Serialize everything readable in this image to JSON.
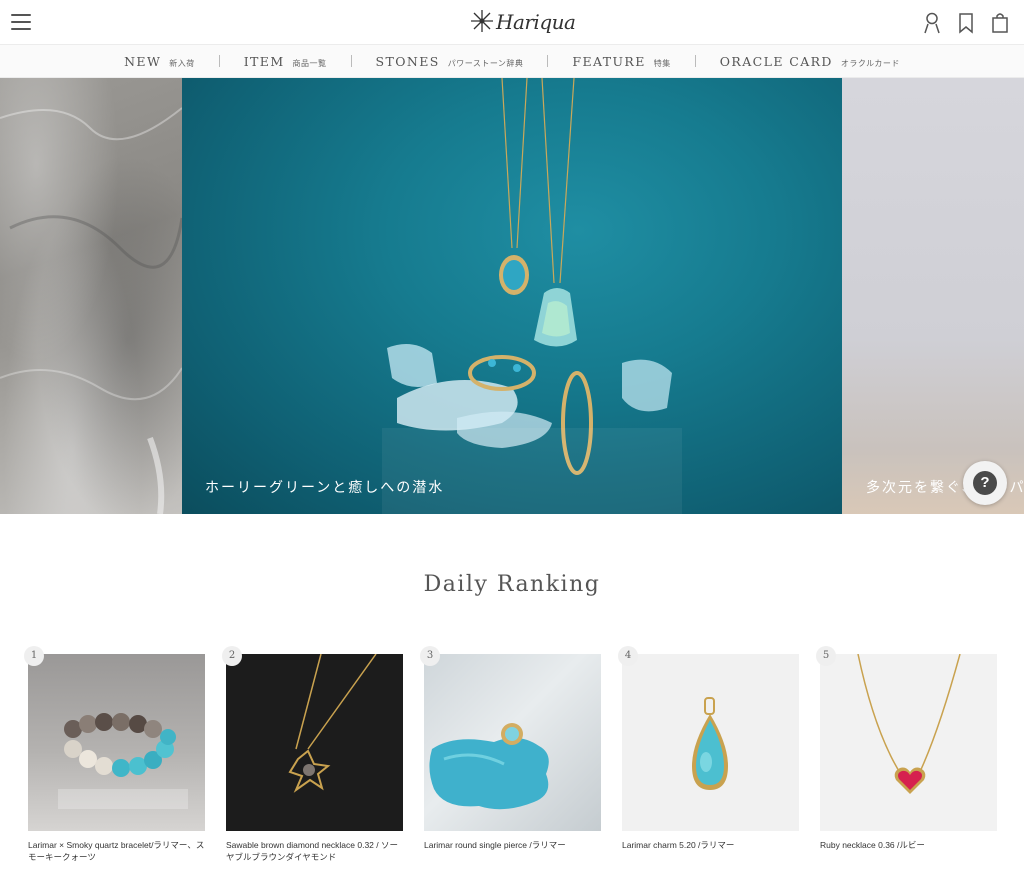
{
  "header": {
    "logo_text": "Hariqua",
    "menu_icon": "hamburger-menu-icon",
    "icons": [
      "user-icon",
      "bookmark-icon",
      "shopping-bag-icon"
    ]
  },
  "nav": {
    "items": [
      {
        "en": "NEW",
        "jp": "新入荷"
      },
      {
        "en": "ITEM",
        "jp": "商品一覧"
      },
      {
        "en": "STONES",
        "jp": "パワーストーン辞典"
      },
      {
        "en": "FEATURE",
        "jp": "特集"
      },
      {
        "en": "ORACLE CARD",
        "jp": "オラクルカード"
      }
    ]
  },
  "hero": {
    "main_caption": "ホーリーグリーンと癒しへの潜水",
    "next_caption": "多次元を繋ぐ、スーパ",
    "help_label": "?"
  },
  "ranking": {
    "title": "Daily Ranking",
    "products": [
      {
        "rank": "1",
        "name": "Larimar × Smoky quartz bracelet/ラリマー、スモーキークォーツ"
      },
      {
        "rank": "2",
        "name": "Sawable brown diamond necklace 0.32 / ソーヤブルブラウンダイヤモンド"
      },
      {
        "rank": "3",
        "name": "Larimar round single pierce /ラリマー"
      },
      {
        "rank": "4",
        "name": "Larimar charm 5.20 /ラリマー"
      },
      {
        "rank": "5",
        "name": "Ruby necklace 0.36 /ルビー"
      }
    ]
  },
  "colors": {
    "hero_teal": "#167b8f",
    "nav_bg": "#fafafa",
    "text": "#444444"
  }
}
